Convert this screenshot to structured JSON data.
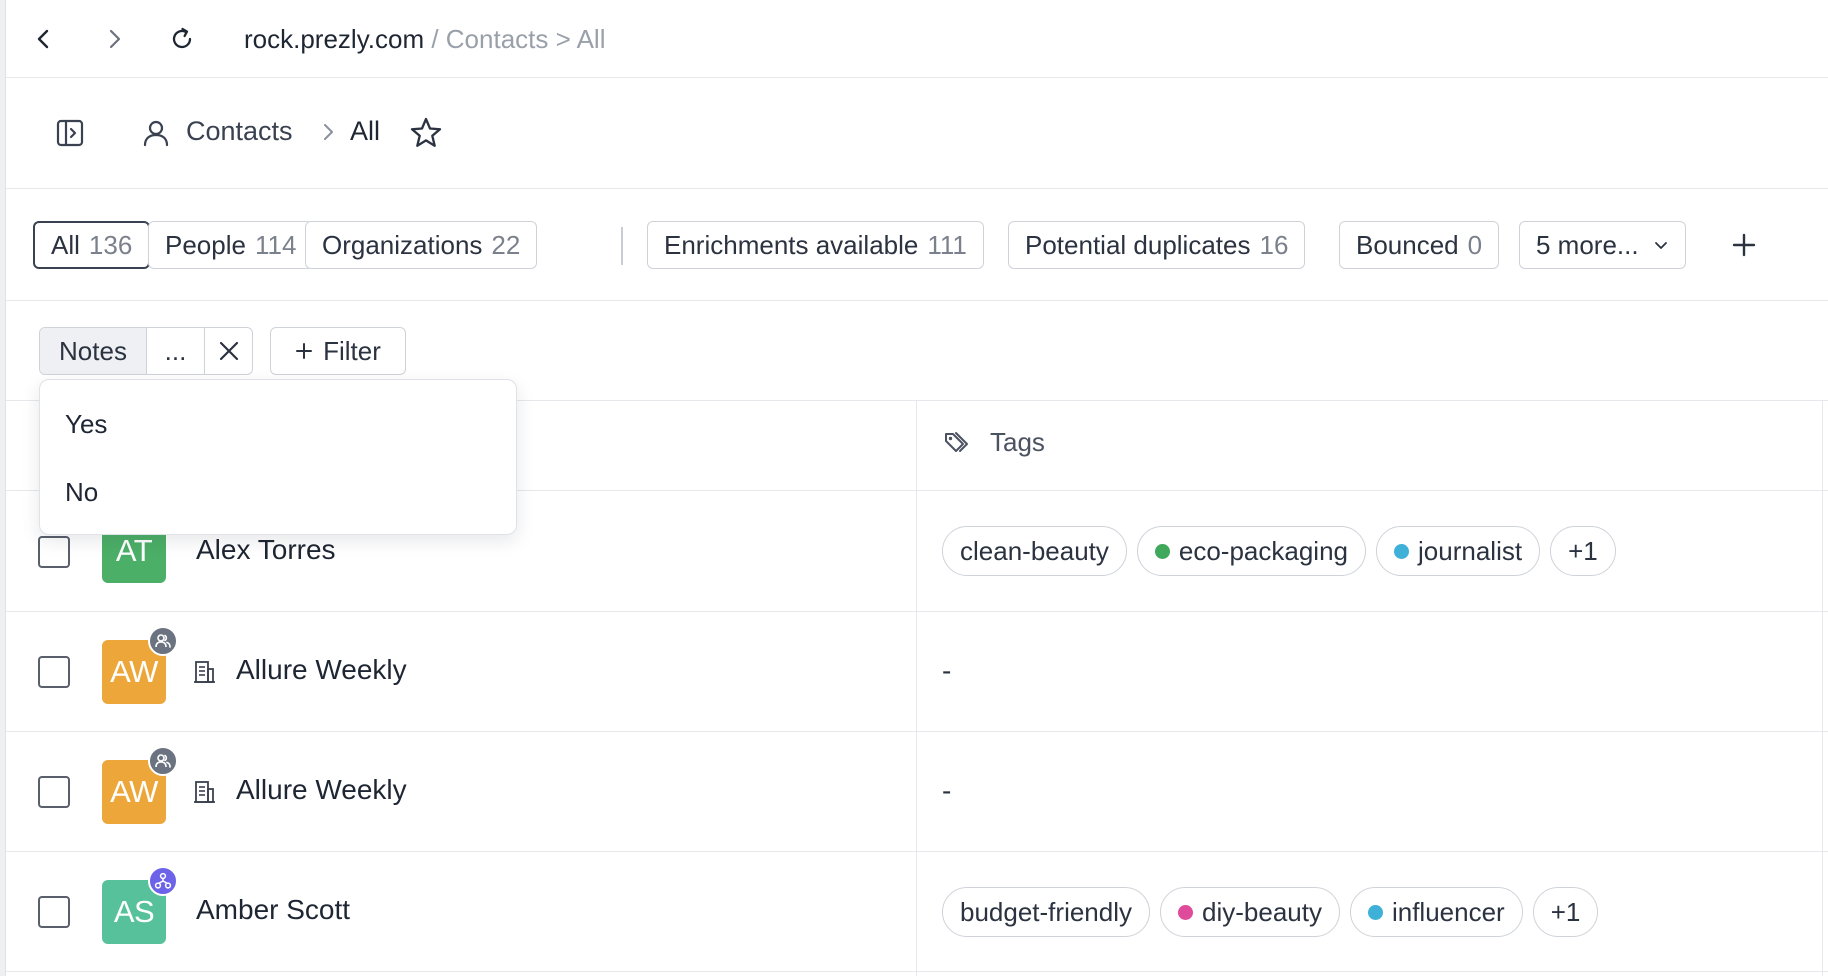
{
  "browser": {
    "host": "rock.prezly.com",
    "path": " / Contacts > All"
  },
  "breadcrumb": {
    "section": "Contacts",
    "current": "All"
  },
  "segments": [
    {
      "label": "All",
      "count": "136",
      "active": true
    },
    {
      "label": "People",
      "count": "114"
    },
    {
      "label": "Organizations",
      "count": "22"
    },
    {
      "label": "Enrichments available",
      "count": "111"
    },
    {
      "label": "Potential duplicates",
      "count": "16"
    },
    {
      "label": "Bounced",
      "count": "0"
    },
    {
      "label": "5 more...",
      "count": ""
    }
  ],
  "filter": {
    "field": "Notes",
    "operator": "...",
    "add_label": "Filter"
  },
  "dropdown": {
    "options": [
      "Yes",
      "No"
    ]
  },
  "table": {
    "tags_header": "Tags",
    "rows": [
      {
        "initials": "AT",
        "name": "Alex Torres",
        "avatar_color": "#4caf67",
        "tags": [
          {
            "label": "clean-beauty",
            "dot": ""
          },
          {
            "label": "eco-packaging",
            "dot": "#3fa85a"
          },
          {
            "label": "journalist",
            "dot": "#3fb0d8"
          },
          {
            "label": "+1",
            "dot": ""
          }
        ]
      },
      {
        "initials": "AW",
        "name": "Allure Weekly",
        "avatar_color": "#eca63a",
        "empty_tags": "-"
      },
      {
        "initials": "AW",
        "name": "Allure Weekly",
        "avatar_color": "#eca63a",
        "empty_tags": "-"
      },
      {
        "initials": "AS",
        "name": "Amber Scott",
        "avatar_color": "#57c19b",
        "tags": [
          {
            "label": "budget-friendly",
            "dot": ""
          },
          {
            "label": "diy-beauty",
            "dot": "#e04a9a"
          },
          {
            "label": "influencer",
            "dot": "#3fb0d8"
          },
          {
            "label": "+1",
            "dot": ""
          }
        ]
      }
    ]
  },
  "colors": {
    "badge_person": "#6b7280",
    "badge_network": "#6c63e8"
  }
}
